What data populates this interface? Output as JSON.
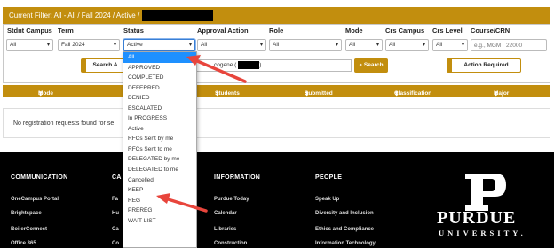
{
  "banner": {
    "text": "Current Filter: All - All / Fall 2024 / Active /"
  },
  "filters": [
    {
      "label": "Stdnt Campus",
      "value": "All"
    },
    {
      "label": "Term",
      "value": "Fall 2024"
    },
    {
      "label": "Status",
      "value": "Active"
    },
    {
      "label": "Approval Action",
      "value": "All"
    },
    {
      "label": "Role",
      "value": "All"
    },
    {
      "label": "Mode",
      "value": "All"
    },
    {
      "label": "Crs Campus",
      "value": "All"
    },
    {
      "label": "Crs Level",
      "value": "All"
    },
    {
      "label": "Course/CRN",
      "placeholder": "e.g., MGMT 22000"
    }
  ],
  "search_row": {
    "left_button": "Search A",
    "text_fragment": "cogene (",
    "text_tail": ")",
    "search_button": "Search",
    "action_button": "Action Required"
  },
  "table": {
    "columns": [
      "Mode",
      "Students",
      "Submitted",
      "Classification",
      "Major"
    ],
    "empty_message": "No registration requests found for se"
  },
  "status_dropdown": {
    "selected": "All",
    "options": [
      "All",
      "APPROVED",
      "COMPLETED",
      "DEFERRED",
      "DENIED",
      "ESCALATED",
      "In PROGRESS",
      "Active",
      "RFCs Sent by me",
      "RFCs Sent to me",
      "DELEGATED by me",
      "DELEGATED to me",
      "Cancelled",
      "KEEP",
      "REG",
      "PREREG",
      "WAIT-LIST"
    ]
  },
  "footer": {
    "columns": [
      {
        "title": "COMMUNICATION",
        "items": [
          "OneCampus Portal",
          "Brightspace",
          "BoilerConnect",
          "Office 365"
        ]
      },
      {
        "title": "CA",
        "items": [
          "Fa",
          "Hu",
          "Ca",
          "Co"
        ]
      },
      {
        "title": "INFORMATION",
        "items": [
          "Purdue Today",
          "Calendar",
          "Libraries",
          "Construction"
        ]
      },
      {
        "title": "PEOPLE",
        "items": [
          "Speak Up",
          "Diversity and Inclusion",
          "Ethics and Compliance",
          "Information Technology"
        ]
      }
    ],
    "logo_word": "PURDUE",
    "logo_sub": "UNIVERSITY."
  },
  "colors": {
    "gold": "#c28e0e",
    "footer_bg": "#000000",
    "selected_option": "#1e90ff",
    "arrow": "#e8453c"
  }
}
